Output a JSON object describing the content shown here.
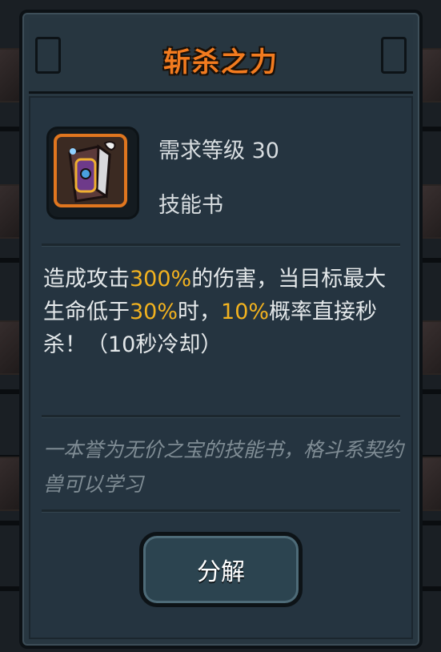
{
  "dialog": {
    "title": "斩杀之力",
    "level_req": "需求等级 30",
    "item_type": "技能书",
    "desc_parts": [
      "造成攻击",
      "300%",
      "的伤害，当目标最大生命低于",
      "30%",
      "时，",
      "10%",
      "概率直接秒杀！（10秒冷却）"
    ],
    "flavor": "一本誉为无价之宝的技能书，格斗系契约兽可以学习",
    "button_label": "分解"
  },
  "colors": {
    "title": "#f27b1f",
    "highlight": "#f2b21f",
    "panel": "#283741",
    "flavor_text": "#7f8c94"
  },
  "icons": {
    "item": "skill-book-icon"
  }
}
